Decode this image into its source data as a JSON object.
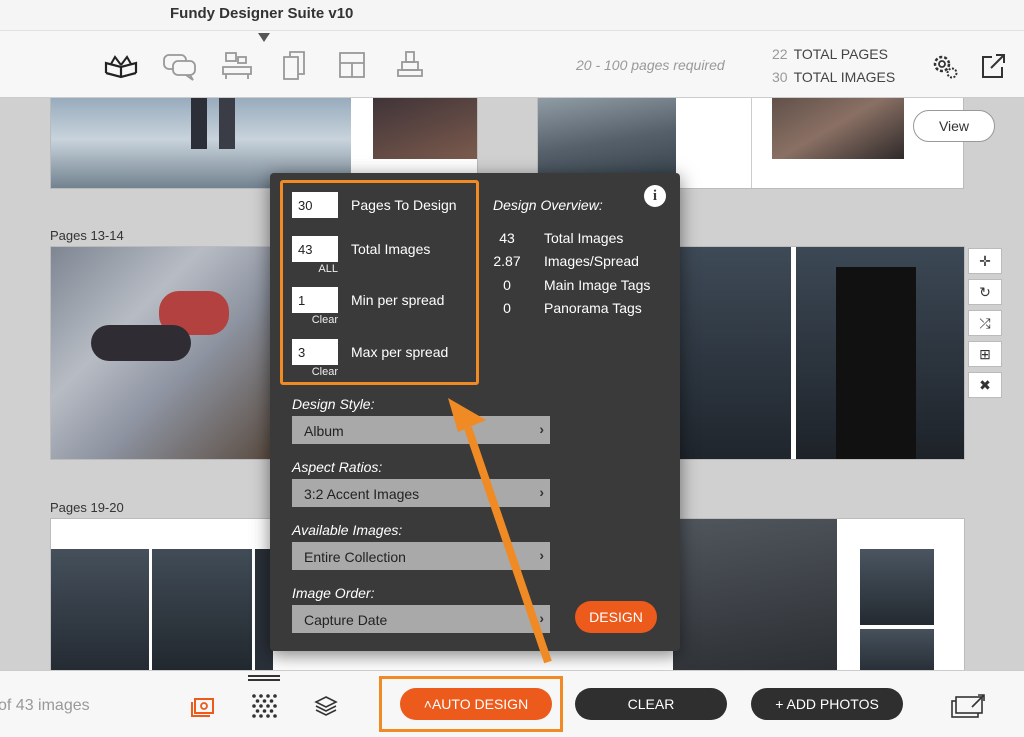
{
  "window": {
    "title": "Fundy Designer Suite v10"
  },
  "toolbar": {
    "icons": [
      "album-design-icon",
      "proofing-chat-icon",
      "wall-art-icon",
      "cards-icon",
      "layout-icon",
      "brand-icon"
    ],
    "pages_required": "20 - 100 pages required",
    "total_pages_num": "22",
    "total_pages_label": "TOTAL PAGES",
    "total_images_num": "30",
    "total_images_label": "TOTAL IMAGES"
  },
  "canvas": {
    "view_button": "View",
    "spread_labels": [
      "Pages 13-14",
      "Pages 19-20"
    ],
    "side_tools": [
      "✛",
      "↻",
      "⤮",
      "⊞",
      "✖"
    ]
  },
  "popup": {
    "fields": [
      {
        "value": "30",
        "label": "Pages To Design",
        "sub": ""
      },
      {
        "value": "43",
        "label": "Total Images",
        "sub": "ALL"
      },
      {
        "value": "1",
        "label": "Min per spread",
        "sub": "Clear"
      },
      {
        "value": "3",
        "label": "Max per spread",
        "sub": "Clear"
      }
    ],
    "overview_title": "Design Overview:",
    "overview": [
      {
        "value": "43",
        "label": "Total Images"
      },
      {
        "value": "2.87",
        "label": "Images/Spread"
      },
      {
        "value": "0",
        "label": "Main Image Tags"
      },
      {
        "value": "0",
        "label": "Panorama Tags"
      }
    ],
    "design_style_label": "Design Style:",
    "design_style_value": "Album",
    "aspect_label": "Aspect Ratios:",
    "aspect_value": "3:2 Accent Images",
    "available_label": "Available Images:",
    "available_value": "Entire Collection",
    "order_label": "Image Order:",
    "order_value": "Capture Date",
    "design_button": "DESIGN",
    "info_glyph": "i"
  },
  "bottom": {
    "count_text": "of 43 images",
    "auto_design": "˄AUTO DESIGN",
    "clear": "CLEAR",
    "add_photos": "+ ADD PHOTOS"
  },
  "colors": {
    "accent": "#ec5a1c",
    "highlight": "#f08a24",
    "popup_bg": "#3a3a3a"
  }
}
